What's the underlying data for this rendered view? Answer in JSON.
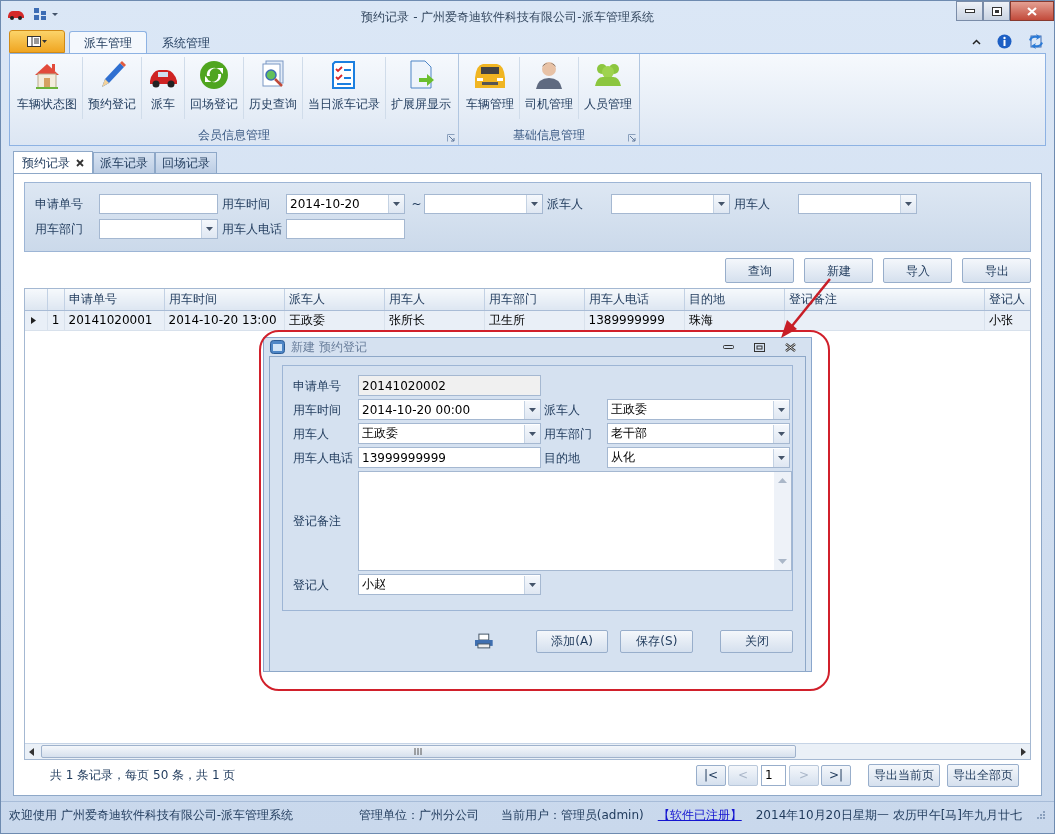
{
  "window": {
    "title": "预约记录 - 广州爱奇迪软件科技有限公司-派车管理系统"
  },
  "ribbon": {
    "tabs": [
      {
        "label": "派车管理",
        "selected": true
      },
      {
        "label": "系统管理",
        "selected": false
      }
    ],
    "groups": [
      {
        "label": "会员信息管理",
        "buttons": [
          "车辆状态图",
          "预约登记",
          "派车",
          "回场登记",
          "历史查询",
          "当日派车记录",
          "扩展屏显示"
        ]
      },
      {
        "label": "基础信息管理",
        "buttons": [
          "车辆管理",
          "司机管理",
          "人员管理"
        ]
      }
    ]
  },
  "doc_tabs": [
    {
      "label": "预约记录",
      "selected": true
    },
    {
      "label": "派车记录",
      "selected": false
    },
    {
      "label": "回场记录",
      "selected": false
    }
  ],
  "filter": {
    "rows": [
      [
        {
          "label": "申请单号",
          "kind": "text"
        },
        {
          "label": "用车时间",
          "kind": "date_range",
          "value": "2014-10-20",
          "separator": "~"
        },
        {
          "label": "派车人",
          "kind": "combo"
        },
        {
          "label": "用车人",
          "kind": "combo"
        }
      ],
      [
        {
          "label": "用车部门",
          "kind": "combo"
        },
        {
          "label": "用车人电话",
          "kind": "text"
        }
      ]
    ]
  },
  "actions": [
    "查询",
    "新建",
    "导入",
    "导出"
  ],
  "grid": {
    "columns": [
      "申请单号",
      "用车时间",
      "派车人",
      "用车人",
      "用车部门",
      "用车人电话",
      "目的地",
      "登记备注",
      "登记人"
    ],
    "rows": [
      {
        "number": "1",
        "selected": true,
        "cells": [
          "20141020001",
          "2014-10-20 13:00",
          "王政委",
          "张所长",
          "卫生所",
          "1389999999",
          "珠海",
          null,
          "小张"
        ]
      }
    ]
  },
  "pager": {
    "summary": "共 1 条记录，每页 50 条，共 1 页",
    "nav": [
      {
        "label": "|<",
        "disabled": false
      },
      {
        "label": "<",
        "disabled": true
      },
      {
        "label": ">",
        "disabled": true
      },
      {
        "label": ">|",
        "disabled": false
      }
    ],
    "page": "1",
    "buttons": [
      "导出当前页",
      "导出全部页"
    ]
  },
  "status_bar": {
    "welcome": "欢迎使用 广州爱奇迪软件科技有限公司-派车管理系统",
    "unit": "管理单位：广州分公司",
    "user": "当前用户：管理员(admin)",
    "registration": "【软件已注册】",
    "date": "2014年10月20日星期一 农历甲午[马]年九月廿七"
  },
  "dialog": {
    "title": "新建 预约登记",
    "rows": [
      [
        {
          "label": "申请单号",
          "kind": "readonly",
          "value": "20141020002"
        }
      ],
      [
        {
          "label": "用车时间",
          "kind": "combo",
          "value": "2014-10-20 00:00"
        },
        {
          "label": "派车人",
          "kind": "combo",
          "value": "王政委"
        }
      ],
      [
        {
          "label": "用车人",
          "kind": "combo",
          "value": "王政委"
        },
        {
          "label": "用车部门",
          "kind": "combo",
          "value": "老干部"
        }
      ],
      [
        {
          "label": "用车人电话",
          "kind": "text",
          "value": "13999999999"
        },
        {
          "label": "目的地",
          "kind": "combo",
          "value": "从化"
        }
      ],
      [
        {
          "label": "登记备注",
          "kind": "memo"
        }
      ],
      [
        {
          "label": "登记人",
          "kind": "combo",
          "value": "小赵"
        }
      ]
    ],
    "buttons": [
      "添加(A)",
      "保存(S)",
      "关闭"
    ]
  }
}
